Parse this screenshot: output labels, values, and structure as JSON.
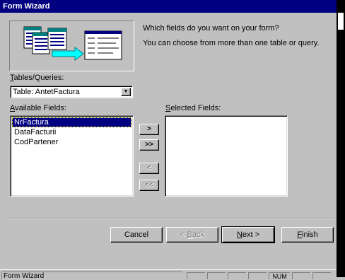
{
  "window": {
    "title": "Form Wizard"
  },
  "instructions": {
    "line1": "Which fields do you want on your form?",
    "line2": "You can choose from more than one table or query."
  },
  "tables_queries": {
    "label_accel": "T",
    "label_rest": "ables/Queries:",
    "selected": "Table: AntetFactura"
  },
  "available_fields": {
    "label_accel": "A",
    "label_rest": "vailable Fields:",
    "items": [
      "NrFactura",
      "DataFacturii",
      "CodPartener"
    ],
    "selected_index": 0
  },
  "selected_fields": {
    "label_accel": "S",
    "label_rest": "elected Fields:",
    "items": []
  },
  "move_buttons": {
    "add_one": ">",
    "add_all": ">>",
    "remove_one": "<",
    "remove_all": "<<"
  },
  "buttons": {
    "cancel": "Cancel",
    "back_accel": "B",
    "back_prefix": "< ",
    "back_rest": "ack",
    "next_accel": "N",
    "next_rest": "ext >",
    "finish_accel": "F",
    "finish_rest": "inish"
  },
  "statusbar": {
    "text": "Form Wizard",
    "num": "NUM"
  },
  "colors": {
    "title_bar": "#000080",
    "face": "#c0c0c0",
    "selection": "#000080"
  }
}
